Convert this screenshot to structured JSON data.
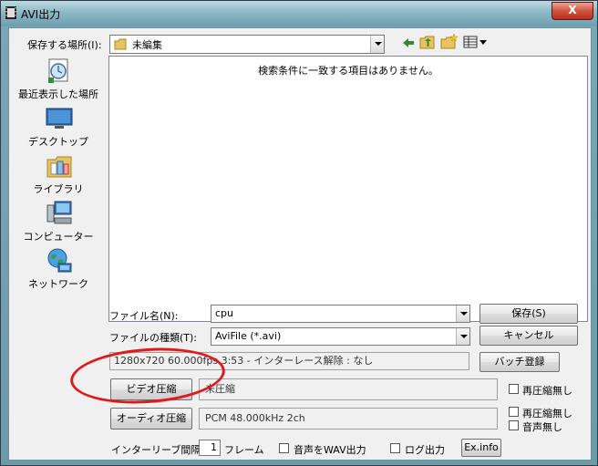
{
  "window": {
    "title": "AVI出力",
    "close_label": "X"
  },
  "save_location": {
    "label": "保存する場所(I):",
    "folder": "未編集"
  },
  "toolbar": {
    "back_icon": "back-arrow-icon",
    "up_icon": "up-folder-icon",
    "new_folder_icon": "new-folder-icon",
    "view_icon": "view-menu-icon"
  },
  "places": [
    {
      "label": "最近表示した場所",
      "icon": "recent-places-icon"
    },
    {
      "label": "デスクトップ",
      "icon": "desktop-icon"
    },
    {
      "label": "ライブラリ",
      "icon": "libraries-icon"
    },
    {
      "label": "コンピューター",
      "icon": "computer-icon"
    },
    {
      "label": "ネットワーク",
      "icon": "network-icon"
    }
  ],
  "file_list": {
    "empty_message": "検索条件に一致する項目はありません。"
  },
  "filename": {
    "label": "ファイル名(N):",
    "value": "cpu"
  },
  "filetype": {
    "label": "ファイルの種類(T):",
    "value": "AviFile (*.avi)"
  },
  "buttons": {
    "save": "保存(S)",
    "cancel": "キャンセル",
    "batch": "バッチ登録",
    "video_compress": "ビデオ圧縮",
    "audio_compress": "オーディオ圧縮",
    "exinfo": "Ex.info"
  },
  "video_info": "1280x720  60.000fps  3:53  -  インターレース解除 : なし",
  "video_codec": "未圧縮",
  "audio_codec": "PCM 48.000kHz 2ch",
  "options": {
    "no_recompress_video": "再圧縮無し",
    "no_recompress_audio": "再圧縮無し",
    "no_audio": "音声無し",
    "interleave_label": "インターリーブ間隔 :",
    "interleave_value": "1",
    "interleave_unit": "フレーム",
    "audio_wav": "音声をWAV出力",
    "log_output": "ログ出力"
  },
  "colors": {
    "annotation_circle": "#e01a1a",
    "titlebar": "#8db8c6"
  }
}
